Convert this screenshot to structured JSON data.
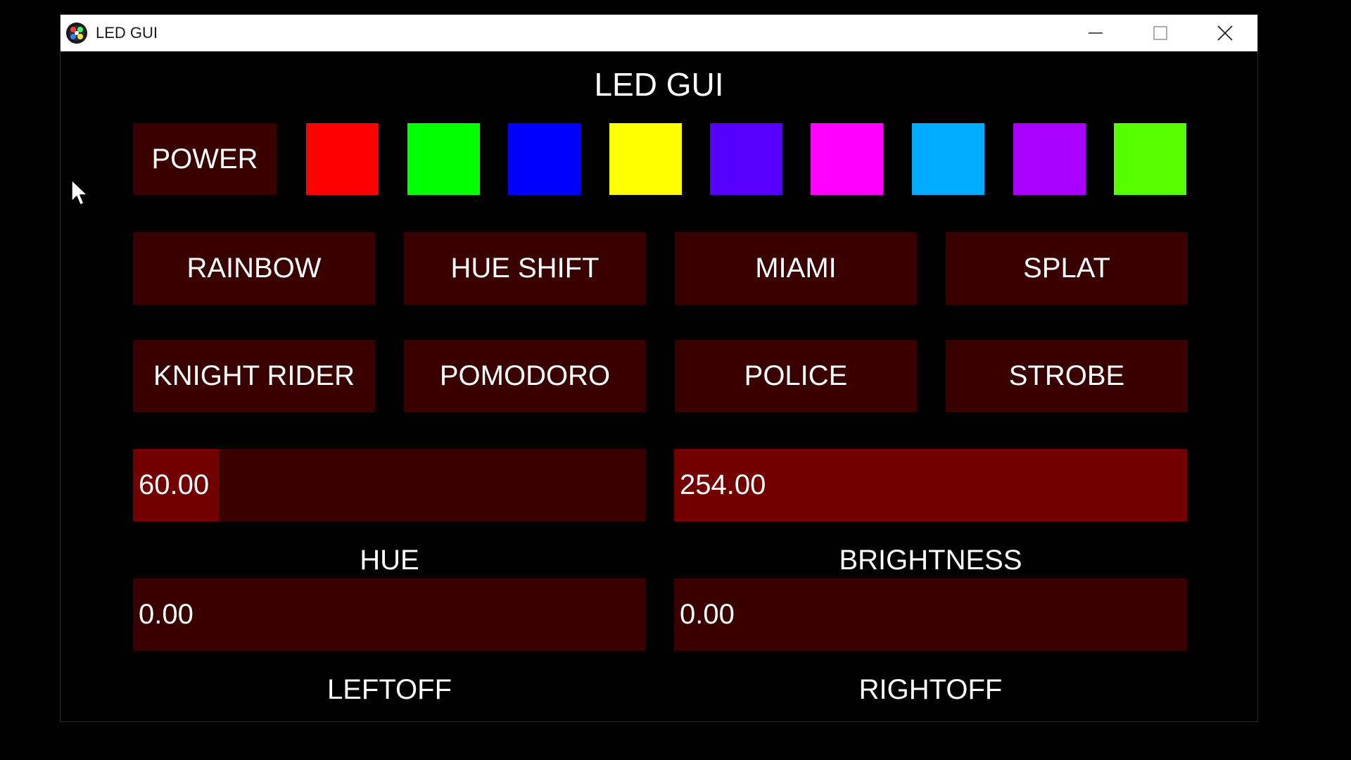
{
  "window": {
    "title": "LED GUI",
    "controls": {
      "minimize_icon": "minimize-icon",
      "maximize_icon": "maximize-icon",
      "close_icon": "close-icon"
    }
  },
  "heading": "LED GUI",
  "power": {
    "label": "POWER"
  },
  "swatches": [
    {
      "color": "#ff0000",
      "name": "red"
    },
    {
      "color": "#00ff00",
      "name": "green"
    },
    {
      "color": "#0000ff",
      "name": "blue"
    },
    {
      "color": "#ffff00",
      "name": "yellow"
    },
    {
      "color": "#5500ff",
      "name": "indigo"
    },
    {
      "color": "#ff00ff",
      "name": "magenta"
    },
    {
      "color": "#00aaff",
      "name": "sky-blue"
    },
    {
      "color": "#aa00ff",
      "name": "purple"
    },
    {
      "color": "#55ff00",
      "name": "lime"
    }
  ],
  "modes": [
    {
      "label": "RAINBOW"
    },
    {
      "label": "HUE SHIFT"
    },
    {
      "label": "MIAMI"
    },
    {
      "label": "SPLAT"
    },
    {
      "label": "KNIGHT RIDER"
    },
    {
      "label": "POMODORO"
    },
    {
      "label": "POLICE"
    },
    {
      "label": "STROBE"
    }
  ],
  "sliders": {
    "hue": {
      "value": "60.00",
      "label": "HUE",
      "fill_fraction": 0.167
    },
    "brightness": {
      "value": "254.00",
      "label": "BRIGHTNESS",
      "fill_fraction": 1.0
    },
    "leftoff": {
      "value": "0.00",
      "label": "LEFTOFF",
      "fill_fraction": 0.0
    },
    "rightoff": {
      "value": "0.00",
      "label": "RIGHTOFF",
      "fill_fraction": 0.0
    }
  },
  "colors": {
    "button_bg": "#3a0000",
    "slider_fill": "#720000",
    "background": "#000000",
    "text": "#ffffff"
  }
}
